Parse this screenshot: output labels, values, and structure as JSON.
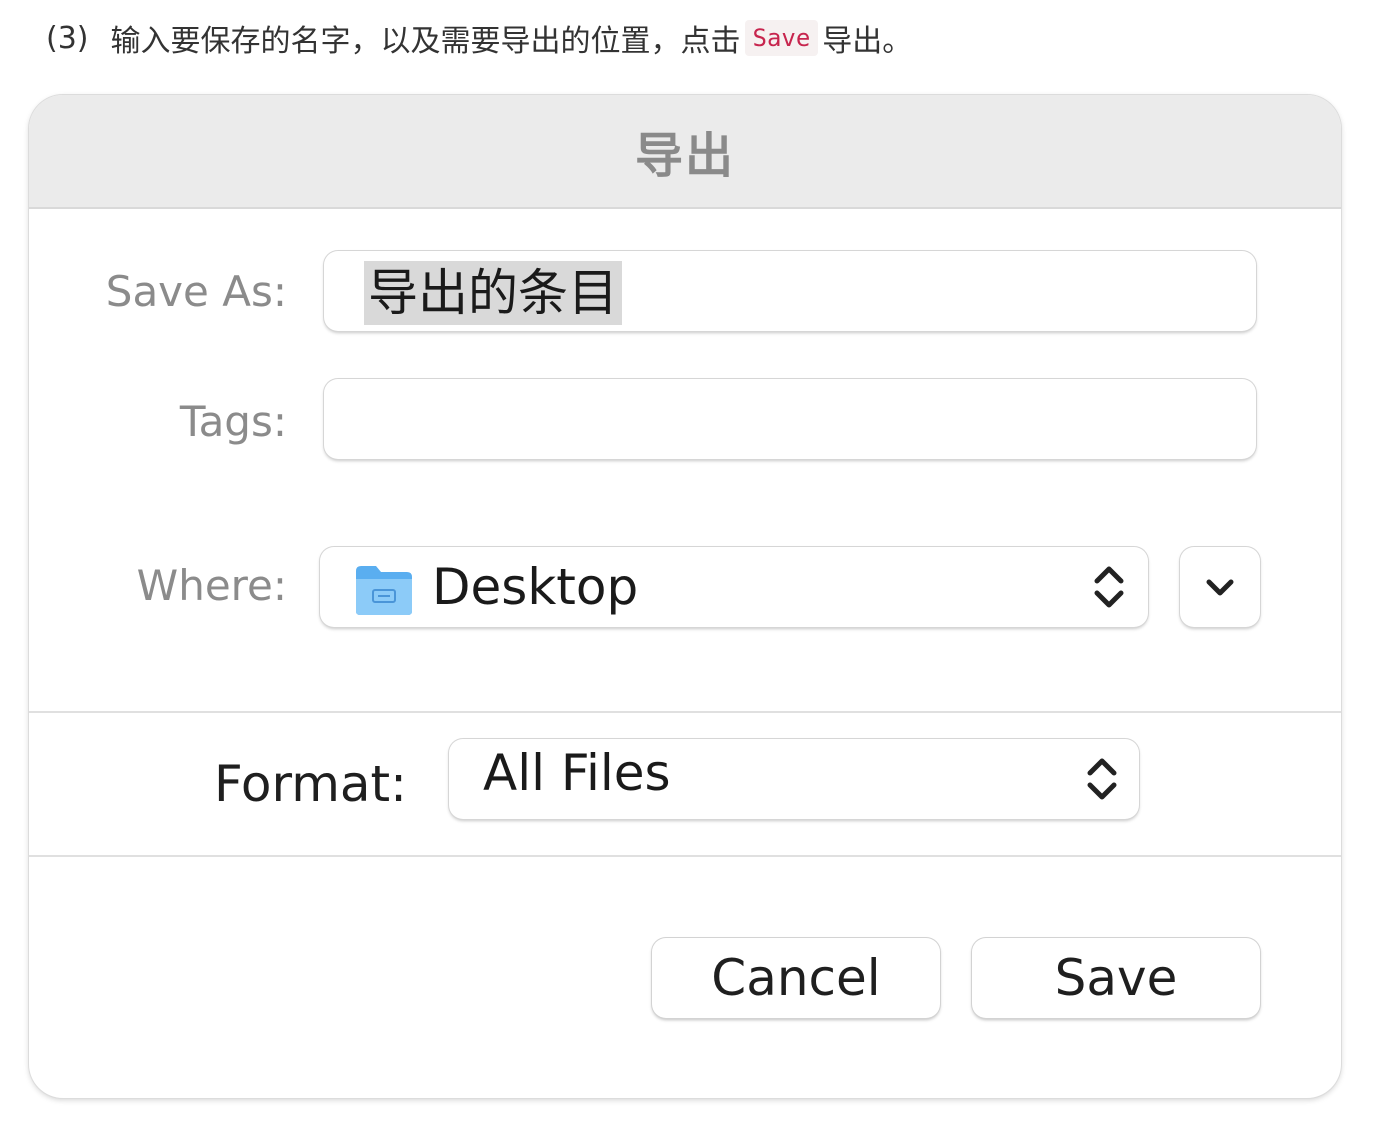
{
  "instruction": {
    "step": "(3)",
    "text_before": "输入要保存的名字，以及需要导出的位置，点击",
    "code": "Save",
    "text_after": "导出。"
  },
  "dialog": {
    "title": "导出",
    "save_as": {
      "label": "Save As:",
      "value": "导出的条目",
      "selected": true
    },
    "tags": {
      "label": "Tags:",
      "value": ""
    },
    "where": {
      "label": "Where:",
      "value": "Desktop",
      "icon": "folder-icon"
    },
    "expand": {
      "icon": "chevron-down-icon"
    },
    "format": {
      "label": "Format:",
      "value": "All Files"
    },
    "buttons": {
      "cancel": "Cancel",
      "save": "Save"
    }
  },
  "colors": {
    "titlebar_bg": "#ebebeb",
    "selection_bg": "#d9d9d9",
    "code_text": "#c7254e",
    "folder_blue": "#5aaef0"
  }
}
